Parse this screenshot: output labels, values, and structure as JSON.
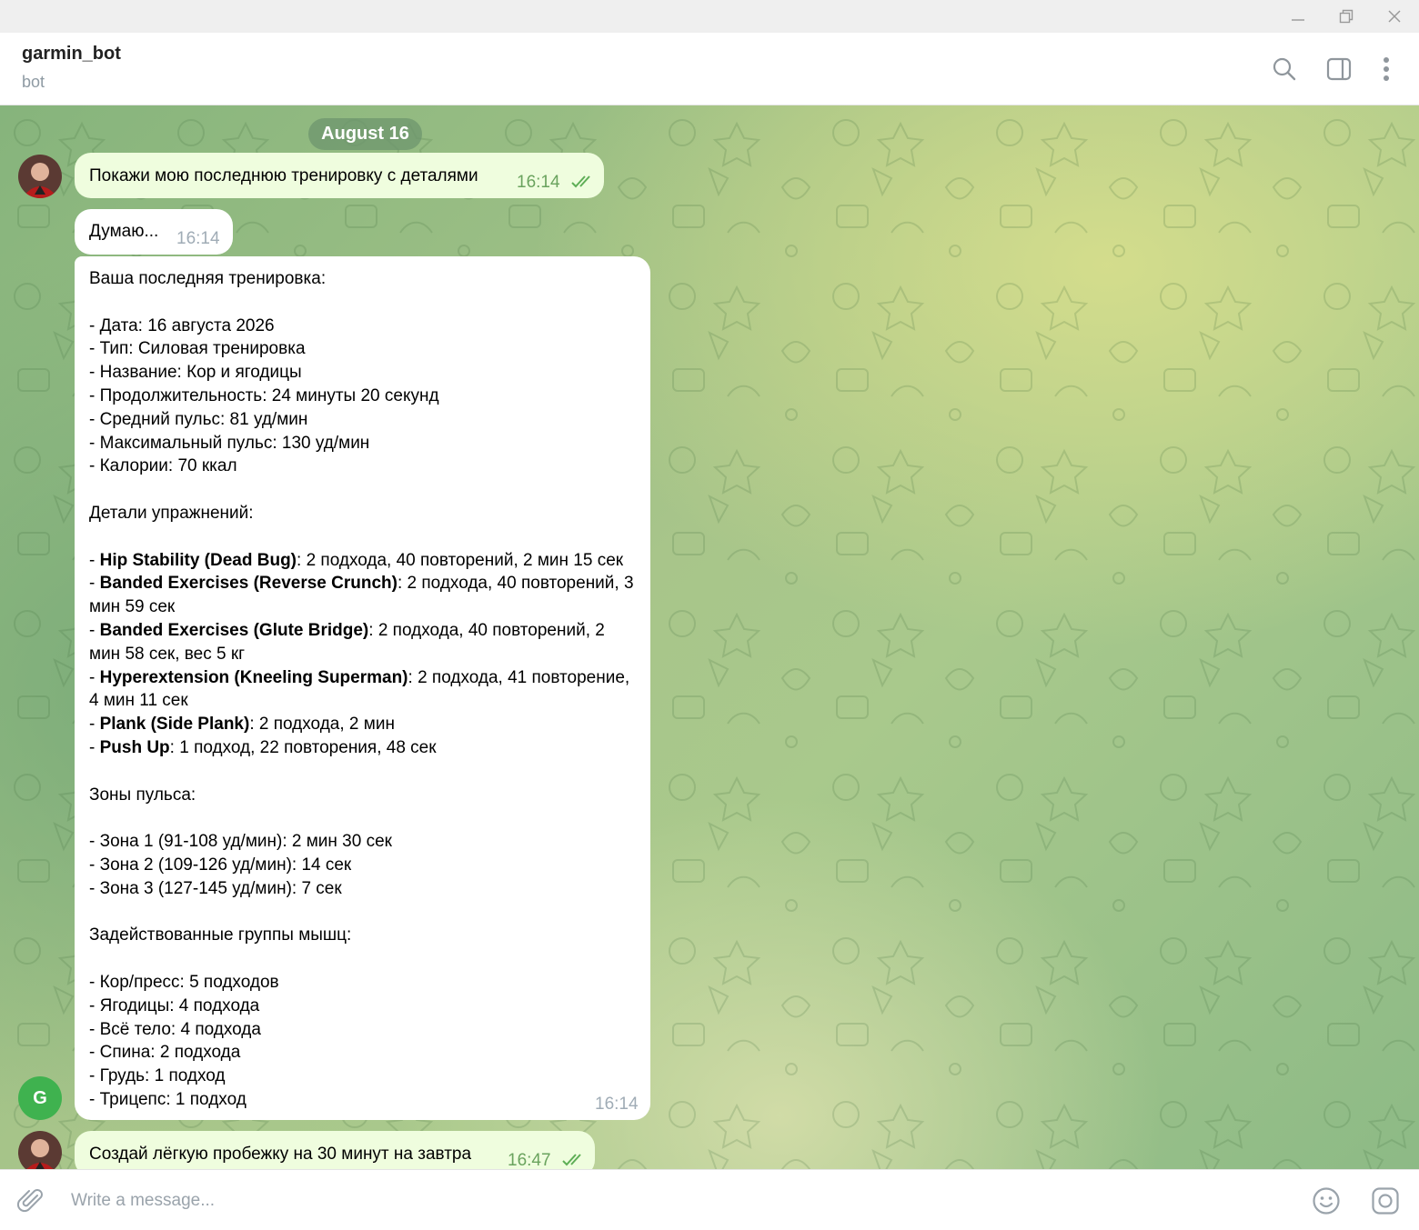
{
  "window": {
    "minimize": "minimize",
    "restore": "restore",
    "close": "close"
  },
  "header": {
    "title": "garmin_bot",
    "subtitle": "bot"
  },
  "chat": {
    "date": "August 16",
    "messages": [
      {
        "from": "user",
        "text": "Покажи мою последнюю тренировку с деталями",
        "time": "16:14"
      },
      {
        "from": "bot",
        "text": "Думаю...",
        "time": "16:14"
      },
      {
        "from": "bot",
        "time": "16:14",
        "lines": [
          [
            {
              "t": "Ваша последняя тренировка:"
            }
          ],
          [],
          [
            {
              "t": "- Дата: 16 августа 2026"
            }
          ],
          [
            {
              "t": "- Тип: Силовая тренировка"
            }
          ],
          [
            {
              "t": "- Название: Кор и ягодицы"
            }
          ],
          [
            {
              "t": "- Продолжительность: 24 минуты 20 секунд"
            }
          ],
          [
            {
              "t": "- Средний пульс: 81 уд/мин"
            }
          ],
          [
            {
              "t": "- Максимальный пульс: 130 уд/мин"
            }
          ],
          [
            {
              "t": "- Калории: 70 ккал"
            }
          ],
          [],
          [
            {
              "t": "Детали упражнений:"
            }
          ],
          [],
          [
            {
              "t": "- "
            },
            {
              "t": "Hip Stability (Dead Bug)",
              "b": true
            },
            {
              "t": ": 2 подхода, 40 повторений, 2 мин 15 сек"
            }
          ],
          [
            {
              "t": "- "
            },
            {
              "t": "Banded Exercises (Reverse Crunch)",
              "b": true
            },
            {
              "t": ": 2 подхода, 40 повторений, 3 мин 59 сек"
            }
          ],
          [
            {
              "t": "- "
            },
            {
              "t": "Banded Exercises (Glute Bridge)",
              "b": true
            },
            {
              "t": ": 2 подхода, 40 повторений, 2 мин 58 сек, вес 5 кг"
            }
          ],
          [
            {
              "t": "- "
            },
            {
              "t": "Hyperextension (Kneeling Superman)",
              "b": true
            },
            {
              "t": ": 2 подхода, 41 повторение, 4 мин 11 сек"
            }
          ],
          [
            {
              "t": "- "
            },
            {
              "t": "Plank (Side Plank)",
              "b": true
            },
            {
              "t": ": 2 подхода, 2 мин"
            }
          ],
          [
            {
              "t": "- "
            },
            {
              "t": "Push Up",
              "b": true
            },
            {
              "t": ": 1 подход, 22 повторения, 48 сек"
            }
          ],
          [],
          [
            {
              "t": "Зоны пульса:"
            }
          ],
          [],
          [
            {
              "t": "- Зона 1 (91-108 уд/мин): 2 мин 30 сек"
            }
          ],
          [
            {
              "t": "- Зона 2 (109-126 уд/мин): 14 сек"
            }
          ],
          [
            {
              "t": "- Зона 3 (127-145 уд/мин): 7 сек"
            }
          ],
          [],
          [
            {
              "t": "Задействованные группы мышц:"
            }
          ],
          [],
          [
            {
              "t": "- Кор/пресс: 5 подходов"
            }
          ],
          [
            {
              "t": "- Ягодицы: 4 подхода"
            }
          ],
          [
            {
              "t": "- Всё тело: 4 подхода"
            }
          ],
          [
            {
              "t": "- Спина: 2 подхода"
            }
          ],
          [
            {
              "t": "- Грудь: 1 подход"
            }
          ],
          [
            {
              "t": "- Трицепс: 1 подход"
            }
          ]
        ]
      },
      {
        "from": "user",
        "text": "Создай лёгкую пробежку на 30 минут на завтра",
        "time": "16:47"
      }
    ],
    "bot_avatar_letter": "G"
  },
  "composer": {
    "placeholder": "Write a message..."
  },
  "colors": {
    "accent": "#5eae56",
    "out_bubble": "#effdde",
    "in_bubble": "#ffffff"
  }
}
